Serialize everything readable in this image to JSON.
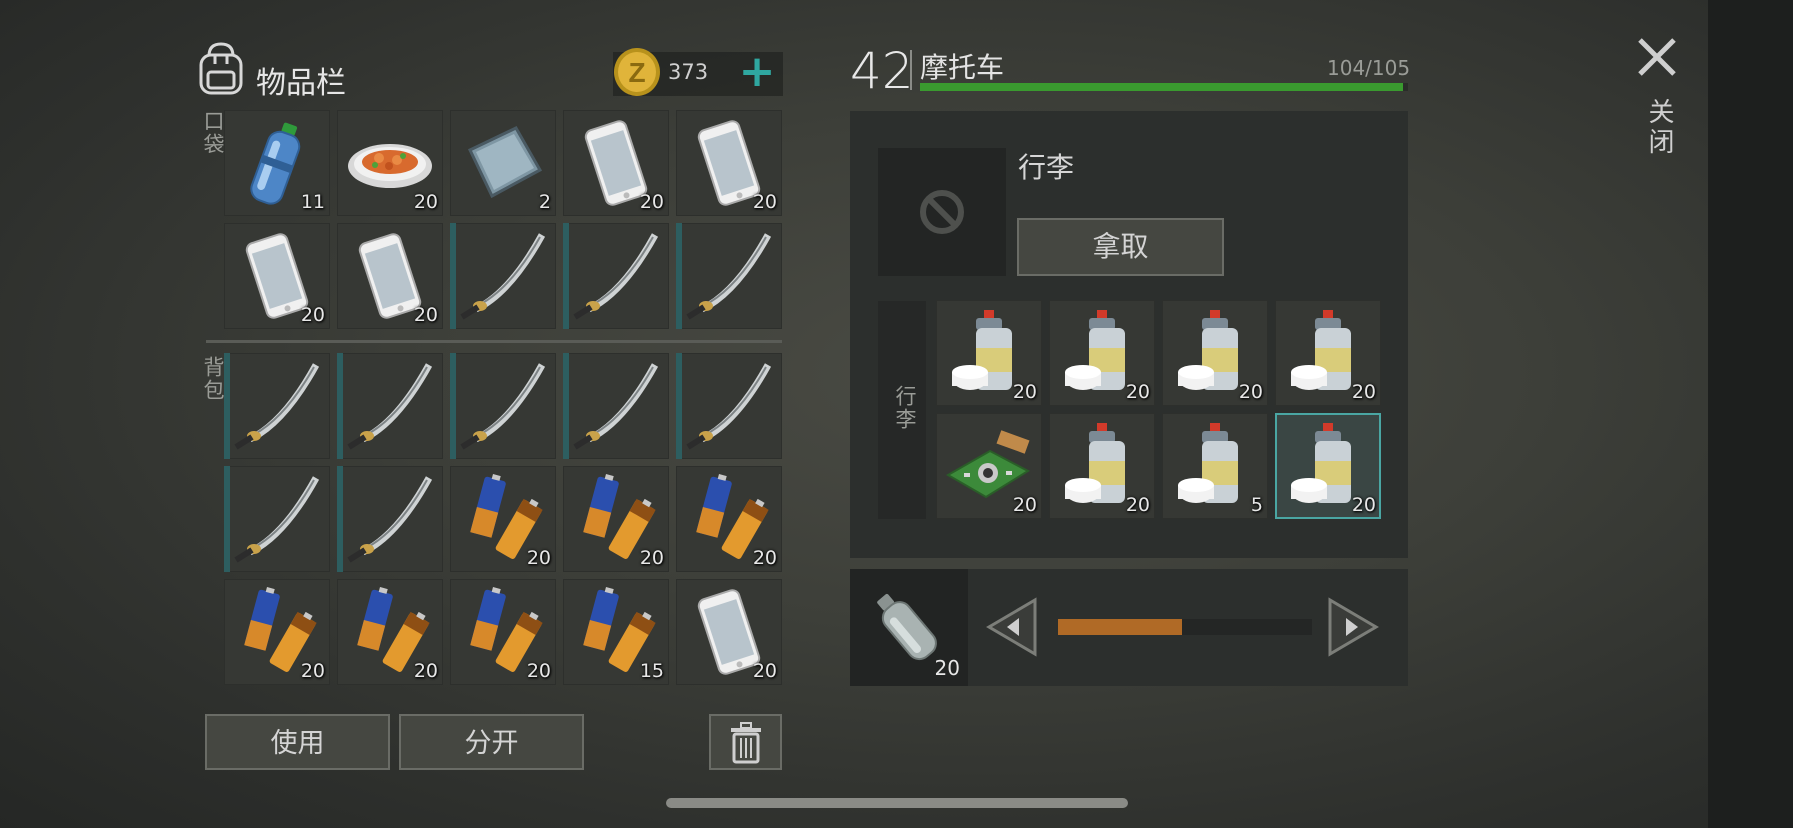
{
  "inventory": {
    "title": "物品栏",
    "currency": "373",
    "pocket_label": "口袋",
    "backpack_label": "背包",
    "pocket": [
      {
        "icon": "water-bottle",
        "qty": "11"
      },
      {
        "icon": "food-plate",
        "qty": "20"
      },
      {
        "icon": "metal-plate",
        "qty": "2"
      },
      {
        "icon": "smartphone",
        "qty": "20"
      },
      {
        "icon": "smartphone",
        "qty": "20"
      },
      {
        "icon": "smartphone",
        "qty": "20"
      },
      {
        "icon": "smartphone",
        "qty": "20"
      },
      {
        "icon": "katana",
        "qty": ""
      },
      {
        "icon": "katana",
        "qty": ""
      },
      {
        "icon": "katana",
        "qty": ""
      }
    ],
    "backpack": [
      {
        "icon": "katana",
        "qty": ""
      },
      {
        "icon": "katana",
        "qty": ""
      },
      {
        "icon": "katana",
        "qty": ""
      },
      {
        "icon": "katana",
        "qty": ""
      },
      {
        "icon": "katana",
        "qty": ""
      },
      {
        "icon": "katana",
        "qty": ""
      },
      {
        "icon": "katana",
        "qty": ""
      },
      {
        "icon": "batteries",
        "qty": "20"
      },
      {
        "icon": "batteries",
        "qty": "20"
      },
      {
        "icon": "batteries",
        "qty": "20"
      },
      {
        "icon": "batteries",
        "qty": "20"
      },
      {
        "icon": "batteries",
        "qty": "20"
      },
      {
        "icon": "batteries",
        "qty": "20"
      },
      {
        "icon": "batteries",
        "qty": "15"
      },
      {
        "icon": "smartphone",
        "qty": "20"
      }
    ],
    "buttons": {
      "use": "使用",
      "split": "分开"
    }
  },
  "vehicle": {
    "level": "42",
    "name": "摩托车",
    "capacity": "104/105",
    "capacity_fraction": 0.99,
    "trunk_title": "行李",
    "take_label": "拿取",
    "trunk_side_label": "行李",
    "trunk_items": [
      {
        "icon": "spray-paint",
        "qty": "20"
      },
      {
        "icon": "spray-paint",
        "qty": "20"
      },
      {
        "icon": "spray-paint",
        "qty": "20"
      },
      {
        "icon": "spray-paint",
        "qty": "20"
      },
      {
        "icon": "circuit-board",
        "qty": "20"
      },
      {
        "icon": "spray-paint",
        "qty": "20"
      },
      {
        "icon": "spray-paint",
        "qty": "5"
      },
      {
        "icon": "spray-paint",
        "qty": "20",
        "selected": true
      }
    ]
  },
  "craft": {
    "item_icon": "empty-bottle",
    "qty": "20",
    "progress_fraction": 0.49
  },
  "close_label": "关闭",
  "colors": {
    "accent": "#2fa7a0",
    "capacity_bar": "#3a9a2f",
    "progress_bar": "#b06a26",
    "selected_border": "#4aa6a3"
  }
}
